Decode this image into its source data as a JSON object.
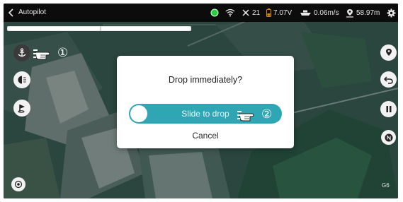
{
  "topbar": {
    "title": "Autopilot",
    "voltage": "7.07V",
    "speed": "0.06m/s",
    "distance": "58.97m",
    "satellites": "21",
    "status_color": "#2ecc40"
  },
  "progress": {
    "value": 1.0
  },
  "callouts": {
    "one": "①",
    "two": "②"
  },
  "dialog": {
    "title": "Drop immediately?",
    "slider_label": "Slide to drop",
    "cancel_label": "Cancel",
    "accent": "#2ea6b4"
  },
  "map": {
    "corner_label": "G6"
  },
  "icons": {
    "left": [
      "anchor-icon",
      "half-moon-icon",
      "flag-icon",
      "locate-icon"
    ],
    "right": [
      "location-pin-icon",
      "return-icon",
      "pause-icon",
      "north-icon"
    ]
  }
}
